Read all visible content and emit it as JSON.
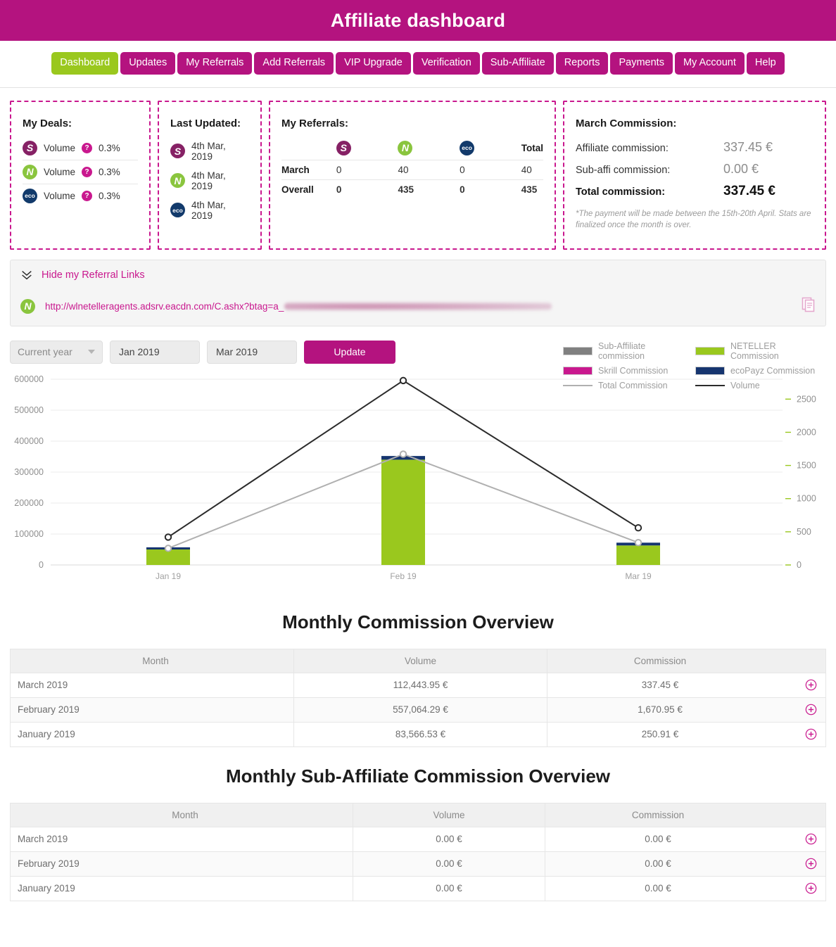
{
  "header": {
    "title": "Affiliate dashboard"
  },
  "nav": {
    "items": [
      {
        "label": "Dashboard",
        "active": true
      },
      {
        "label": "Updates",
        "active": false
      },
      {
        "label": "My Referrals",
        "active": false
      },
      {
        "label": "Add Referrals",
        "active": false
      },
      {
        "label": "VIP Upgrade",
        "active": false
      },
      {
        "label": "Verification",
        "active": false
      },
      {
        "label": "Sub-Affiliate",
        "active": false
      },
      {
        "label": "Reports",
        "active": false
      },
      {
        "label": "Payments",
        "active": false
      },
      {
        "label": "My Account",
        "active": false
      },
      {
        "label": "Help",
        "active": false
      }
    ]
  },
  "brands": {
    "skrill": {
      "icon": "skrill-logo",
      "glyph": "S",
      "color": "#862165"
    },
    "neteller": {
      "icon": "neteller-logo",
      "glyph": "N",
      "color": "#8ac53e"
    },
    "ecopayz": {
      "icon": "ecopayz-logo",
      "glyph": "eco",
      "color": "#123a6b"
    }
  },
  "my_deals": {
    "title": "My Deals:",
    "help_glyph": "?",
    "rows": [
      {
        "brand": "skrill",
        "metric": "Volume",
        "value": "0.3%"
      },
      {
        "brand": "neteller",
        "metric": "Volume",
        "value": "0.3%"
      },
      {
        "brand": "ecopayz",
        "metric": "Volume",
        "value": "0.3%"
      }
    ]
  },
  "last_updated": {
    "title": "Last Updated:",
    "rows": [
      {
        "brand": "skrill",
        "date": "4th Mar, 2019"
      },
      {
        "brand": "neteller",
        "date": "4th Mar, 2019"
      },
      {
        "brand": "ecopayz",
        "date": "4th Mar, 2019"
      }
    ]
  },
  "my_referrals": {
    "title": "My Referrals:",
    "total_header": "Total",
    "rows": [
      {
        "label": "March",
        "skrill": "0",
        "neteller": "40",
        "ecopayz": "0",
        "total": "40"
      },
      {
        "label": "Overall",
        "skrill": "0",
        "neteller": "435",
        "ecopayz": "0",
        "total": "435"
      }
    ]
  },
  "march_commission": {
    "title": "March Commission:",
    "affiliate_label": "Affiliate commission:",
    "affiliate_value": "337.45 €",
    "subaffi_label": "Sub-affi commission:",
    "subaffi_value": "0.00 €",
    "total_label": "Total commission:",
    "total_value": "337.45 €",
    "note": "*The payment will be made between the 15th-20th April. Stats are finalized once the month is over."
  },
  "referral_links": {
    "toggle_label": "Hide my Referral Links",
    "link_brand": "neteller",
    "url_visible": "http://wlnetelleragents.adsrv.eacdn.com/C.ashx?btag=a_",
    "copy_icon": "copy-icon"
  },
  "filters": {
    "period_value": "Current year",
    "from_value": "Jan 2019",
    "to_value": "Mar 2019",
    "update_label": "Update"
  },
  "chart_data": {
    "type": "bar",
    "title": "",
    "categories": [
      "Jan 19",
      "Feb 19",
      "Mar 19"
    ],
    "ylabel": "",
    "xlabel": "",
    "ylim": [
      0,
      600000
    ],
    "yticks": [
      0,
      100000,
      200000,
      300000,
      400000,
      500000,
      600000
    ],
    "y2lim": [
      0,
      2800
    ],
    "y2ticks": [
      0,
      500,
      1000,
      1500,
      2000,
      2500
    ],
    "grid": true,
    "legend_position": "top-right",
    "legend": [
      {
        "label": "Sub-Affiliate commission",
        "color": "#808080",
        "kind": "swatch"
      },
      {
        "label": "NETELLER Commission",
        "color": "#9ac81e",
        "kind": "swatch"
      },
      {
        "label": "Skrill Commission",
        "color": "#c9188e",
        "kind": "swatch"
      },
      {
        "label": "ecoPayz Commission",
        "color": "#16356f",
        "kind": "swatch"
      },
      {
        "label": "Total Commission",
        "color": "#b0b0b0",
        "kind": "line"
      },
      {
        "label": "Volume",
        "color": "#2b2b2b",
        "kind": "line"
      }
    ],
    "series": [
      {
        "name": "NETELLER Commission",
        "axis": "left",
        "type": "bar",
        "values": [
          50000,
          340000,
          63000
        ]
      },
      {
        "name": "ecoPayz Commission",
        "axis": "left",
        "type": "bar",
        "values": [
          7000,
          12000,
          9000
        ]
      },
      {
        "name": "Skrill Commission",
        "axis": "left",
        "type": "bar",
        "values": [
          0,
          0,
          0
        ]
      },
      {
        "name": "Sub-Affiliate commission",
        "axis": "left",
        "type": "bar",
        "values": [
          0,
          0,
          0
        ]
      },
      {
        "name": "Total Commission",
        "axis": "right",
        "type": "line",
        "values": [
          250.91,
          1670.95,
          337.45
        ]
      },
      {
        "name": "Volume",
        "axis": "right",
        "type": "line",
        "values": [
          420,
          2780,
          560
        ]
      }
    ]
  },
  "commission_overview": {
    "heading": "Monthly Commission Overview",
    "columns": [
      "Month",
      "Volume",
      "Commission"
    ],
    "rows": [
      {
        "month": "March 2019",
        "volume": "112,443.95 €",
        "commission": "337.45 €"
      },
      {
        "month": "February 2019",
        "volume": "557,064.29 €",
        "commission": "1,670.95 €"
      },
      {
        "month": "January 2019",
        "volume": "83,566.53 €",
        "commission": "250.91 €"
      }
    ]
  },
  "subaffiliate_overview": {
    "heading": "Monthly Sub-Affiliate Commission Overview",
    "columns": [
      "Month",
      "Volume",
      "Commission"
    ],
    "rows": [
      {
        "month": "March 2019",
        "volume": "0.00 €",
        "commission": "0.00 €"
      },
      {
        "month": "February 2019",
        "volume": "0.00 €",
        "commission": "0.00 €"
      },
      {
        "month": "January 2019",
        "volume": "0.00 €",
        "commission": "0.00 €"
      }
    ]
  }
}
